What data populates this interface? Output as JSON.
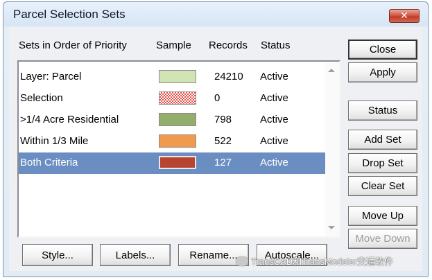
{
  "window": {
    "title": "Parcel Selection Sets",
    "close_glyph": "✕"
  },
  "list": {
    "headers": {
      "name": "Sets in Order of Priority",
      "sample": "Sample",
      "records": "Records",
      "status": "Status"
    },
    "rows": [
      {
        "name": "Layer: Parcel",
        "records": "24210",
        "status": "Active",
        "sample_color": "#d2e4b6",
        "sample_pattern": "solid"
      },
      {
        "name": "Selection",
        "records": "0",
        "status": "Active",
        "sample_color": "#e8504a",
        "sample_pattern": "checker"
      },
      {
        "name": ">1/4 Acre Residential",
        "records": "798",
        "status": "Active",
        "sample_color": "#93ad6a",
        "sample_pattern": "solid"
      },
      {
        "name": "Within 1/3 Mile",
        "records": "522",
        "status": "Active",
        "sample_color": "#f19a4e",
        "sample_pattern": "solid"
      },
      {
        "name": "Both Criteria",
        "records": "127",
        "status": "Active",
        "sample_color": "#b84430",
        "sample_pattern": "solid"
      }
    ],
    "selected_index": 4
  },
  "buttons": {
    "close": "Close",
    "apply": "Apply",
    "status": "Status",
    "add_set": "Add Set",
    "drop_set": "Drop Set",
    "clear_set": "Clear Set",
    "move_up": "Move Up",
    "move_down": "Move Down",
    "style": "Style...",
    "labels": "Labels...",
    "rename": "Rename...",
    "autoscale": "Autoscale..."
  },
  "watermark": "TransCAD和TransModeler交通软件",
  "colors": {
    "selection": "#6b8ec2",
    "close_button": "#c23b25"
  }
}
